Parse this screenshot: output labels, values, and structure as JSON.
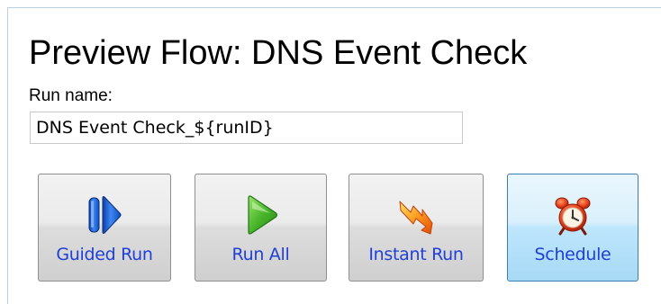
{
  "page": {
    "title": "Preview Flow: DNS Event Check",
    "run_name_label": "Run name:",
    "run_name_value": "DNS Event Check_${runID}"
  },
  "buttons": [
    {
      "label": "Guided Run",
      "icon": "guided-run-icon"
    },
    {
      "label": "Run All",
      "icon": "play-icon"
    },
    {
      "label": "Instant Run",
      "icon": "lightning-bolt-icon"
    },
    {
      "label": "Schedule",
      "icon": "alarm-clock-icon",
      "selected": true
    }
  ],
  "colors": {
    "button_label": "#1f3fd6",
    "panel_border": "#b9cfe4",
    "selected_border": "#3c7fb1"
  }
}
